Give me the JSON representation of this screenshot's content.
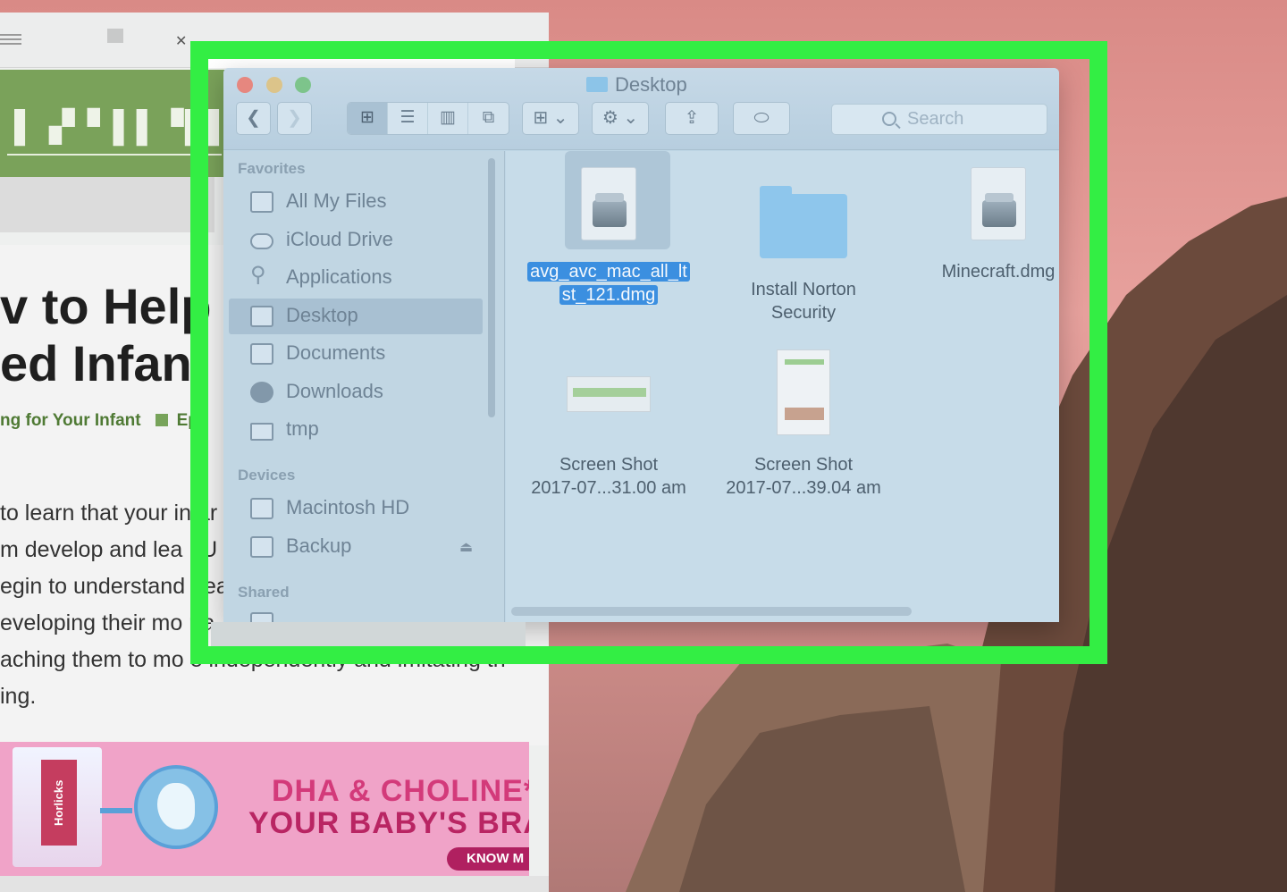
{
  "browser": {
    "logo_text": "▌▗▘▘▌▌▝▌▌▗▌g.",
    "title_line1": "v to Help a",
    "title_line2": "ed Infant",
    "category": "ng for Your Infant",
    "category_tail": "Epi",
    "body_lines": [
      "to learn that your infar",
      "m develop and lea . U",
      "egin to understand hea",
      "eveloping their mo r a",
      "aching them to mo e independently and imitating th",
      "ing."
    ],
    "ad": {
      "brand": "Horlicks",
      "line1": "DHA & CHOLINE*",
      "line2": "YOUR BABY'S BRAI",
      "cta": "KNOW M"
    }
  },
  "finder": {
    "title": "Desktop",
    "toolbar": {
      "back_icon": "chevron-left-icon",
      "forward_icon": "chevron-right-icon",
      "view_icons": [
        "icon-view-icon",
        "list-view-icon",
        "column-view-icon",
        "cover-flow-icon"
      ],
      "arrange_icon": "arrange-grid-icon",
      "action_icon": "gear-icon",
      "share_icon": "share-icon",
      "tag_icon": "tag-icon",
      "search_placeholder": "Search"
    },
    "sidebar": {
      "favorites_label": "Favorites",
      "favorites": [
        {
          "label": "All My Files",
          "icon": "all-files-icon"
        },
        {
          "label": "iCloud Drive",
          "icon": "cloud-icon"
        },
        {
          "label": "Applications",
          "icon": "applications-icon"
        },
        {
          "label": "Desktop",
          "icon": "desktop-icon"
        },
        {
          "label": "Documents",
          "icon": "documents-icon"
        },
        {
          "label": "Downloads",
          "icon": "downloads-icon"
        },
        {
          "label": "tmp",
          "icon": "folder-icon"
        }
      ],
      "devices_label": "Devices",
      "devices": [
        {
          "label": "Macintosh HD",
          "icon": "hard-drive-icon"
        },
        {
          "label": "Backup",
          "icon": "hard-drive-icon"
        }
      ],
      "shared_label": "Shared"
    },
    "files": [
      {
        "name_line1": "avg_avc_mac_all_lt",
        "name_line2": "st_121.dmg",
        "type": "dmg",
        "selected": true
      },
      {
        "name_line1": "Install Norton",
        "name_line2": "Security",
        "type": "folder",
        "selected": false
      },
      {
        "name_line1": "Minecraft.dmg",
        "name_line2": "",
        "type": "dmg",
        "selected": false
      },
      {
        "name_line1": "Screen Shot",
        "name_line2": "2017-07...31.00 am",
        "type": "screenshot",
        "selected": false
      },
      {
        "name_line1": "Screen Shot",
        "name_line2": "2017-07...39.04 am",
        "type": "screenshot",
        "selected": false
      }
    ]
  },
  "highlight_color": "#33ee44"
}
